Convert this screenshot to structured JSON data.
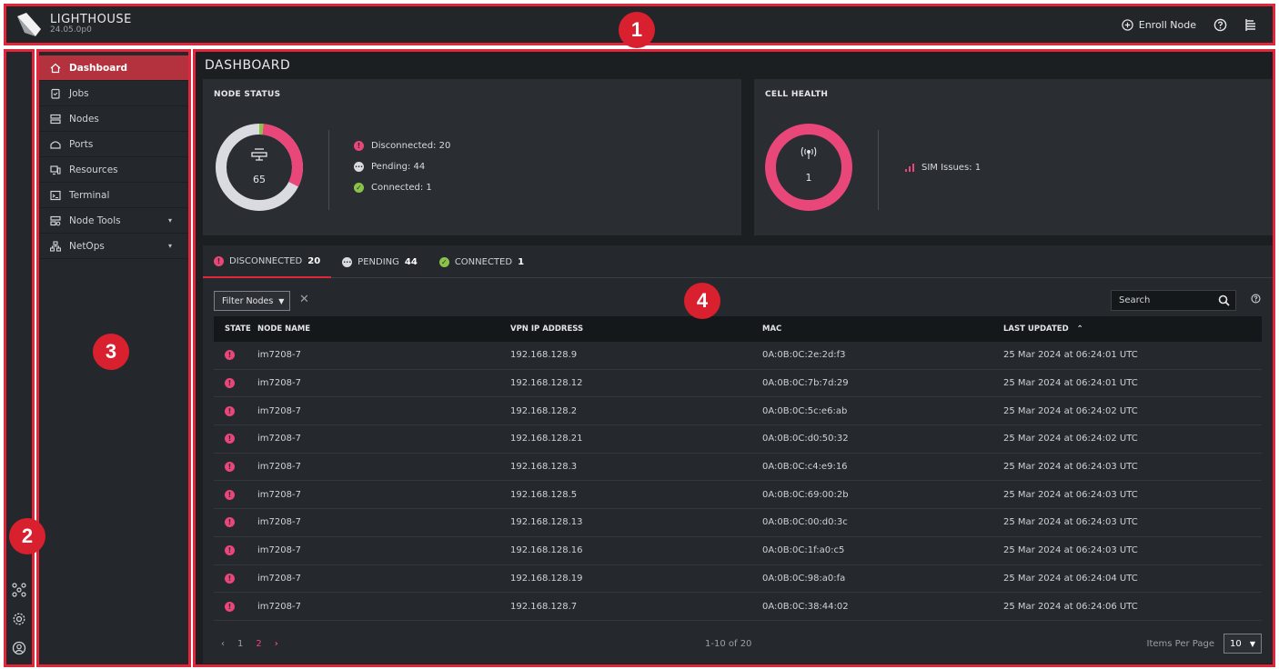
{
  "header": {
    "brand": "LIGHTHOUSE",
    "version": "24.05.0p0",
    "enroll_label": "Enroll Node"
  },
  "sidebar": {
    "items": [
      {
        "label": "Dashboard",
        "icon": "home-icon",
        "active": true
      },
      {
        "label": "Jobs",
        "icon": "clipboard-icon"
      },
      {
        "label": "Nodes",
        "icon": "server-icon"
      },
      {
        "label": "Ports",
        "icon": "port-icon"
      },
      {
        "label": "Resources",
        "icon": "resources-icon"
      },
      {
        "label": "Terminal",
        "icon": "terminal-icon"
      },
      {
        "label": "Node Tools",
        "icon": "node-tools-icon",
        "expandable": true
      },
      {
        "label": "NetOps",
        "icon": "netops-icon",
        "expandable": true
      }
    ]
  },
  "main": {
    "title": "DASHBOARD",
    "node_status": {
      "title": "NODE STATUS",
      "total": "65",
      "legend": [
        {
          "label": "Disconnected: 20",
          "color": "#e9467a",
          "value": 20
        },
        {
          "label": "Pending: 44",
          "color": "#d9dbe0",
          "value": 44
        },
        {
          "label": "Connected: 1",
          "color": "#8bc34a",
          "value": 1
        }
      ]
    },
    "cell_health": {
      "title": "CELL HEALTH",
      "total": "1",
      "legend_label": "SIM Issues: 1",
      "color": "#e9467a"
    },
    "tabs": [
      {
        "label": "DISCONNECTED",
        "count": "20",
        "active": true
      },
      {
        "label": "PENDING",
        "count": "44"
      },
      {
        "label": "CONNECTED",
        "count": "1"
      }
    ],
    "filter_label": "Filter Nodes",
    "search_placeholder": "Search",
    "table": {
      "headers": {
        "state": "STATE",
        "name": "NODE NAME",
        "ip": "VPN IP ADDRESS",
        "mac": "MAC",
        "updated": "LAST UPDATED"
      },
      "rows": [
        {
          "name": "im7208-7",
          "ip": "192.168.128.9",
          "mac": "0A:0B:0C:2e:2d:f3",
          "updated": "25 Mar 2024 at 06:24:01 UTC"
        },
        {
          "name": "im7208-7",
          "ip": "192.168.128.12",
          "mac": "0A:0B:0C:7b:7d:29",
          "updated": "25 Mar 2024 at 06:24:01 UTC"
        },
        {
          "name": "im7208-7",
          "ip": "192.168.128.2",
          "mac": "0A:0B:0C:5c:e6:ab",
          "updated": "25 Mar 2024 at 06:24:02 UTC"
        },
        {
          "name": "im7208-7",
          "ip": "192.168.128.21",
          "mac": "0A:0B:0C:d0:50:32",
          "updated": "25 Mar 2024 at 06:24:02 UTC"
        },
        {
          "name": "im7208-7",
          "ip": "192.168.128.3",
          "mac": "0A:0B:0C:c4:e9:16",
          "updated": "25 Mar 2024 at 06:24:03 UTC"
        },
        {
          "name": "im7208-7",
          "ip": "192.168.128.5",
          "mac": "0A:0B:0C:69:00:2b",
          "updated": "25 Mar 2024 at 06:24:03 UTC"
        },
        {
          "name": "im7208-7",
          "ip": "192.168.128.13",
          "mac": "0A:0B:0C:00:d0:3c",
          "updated": "25 Mar 2024 at 06:24:03 UTC"
        },
        {
          "name": "im7208-7",
          "ip": "192.168.128.16",
          "mac": "0A:0B:0C:1f:a0:c5",
          "updated": "25 Mar 2024 at 06:24:03 UTC"
        },
        {
          "name": "im7208-7",
          "ip": "192.168.128.19",
          "mac": "0A:0B:0C:98:a0:fa",
          "updated": "25 Mar 2024 at 06:24:04 UTC"
        },
        {
          "name": "im7208-7",
          "ip": "192.168.128.7",
          "mac": "0A:0B:0C:38:44:02",
          "updated": "25 Mar 2024 at 06:24:06 UTC"
        }
      ]
    },
    "pagination": {
      "pages": [
        "1",
        "2"
      ],
      "current": "2",
      "range": "1-10 of 20",
      "per_page_label": "Items Per Page",
      "per_page_value": "10"
    }
  },
  "callouts": [
    "1",
    "2",
    "3",
    "4"
  ]
}
